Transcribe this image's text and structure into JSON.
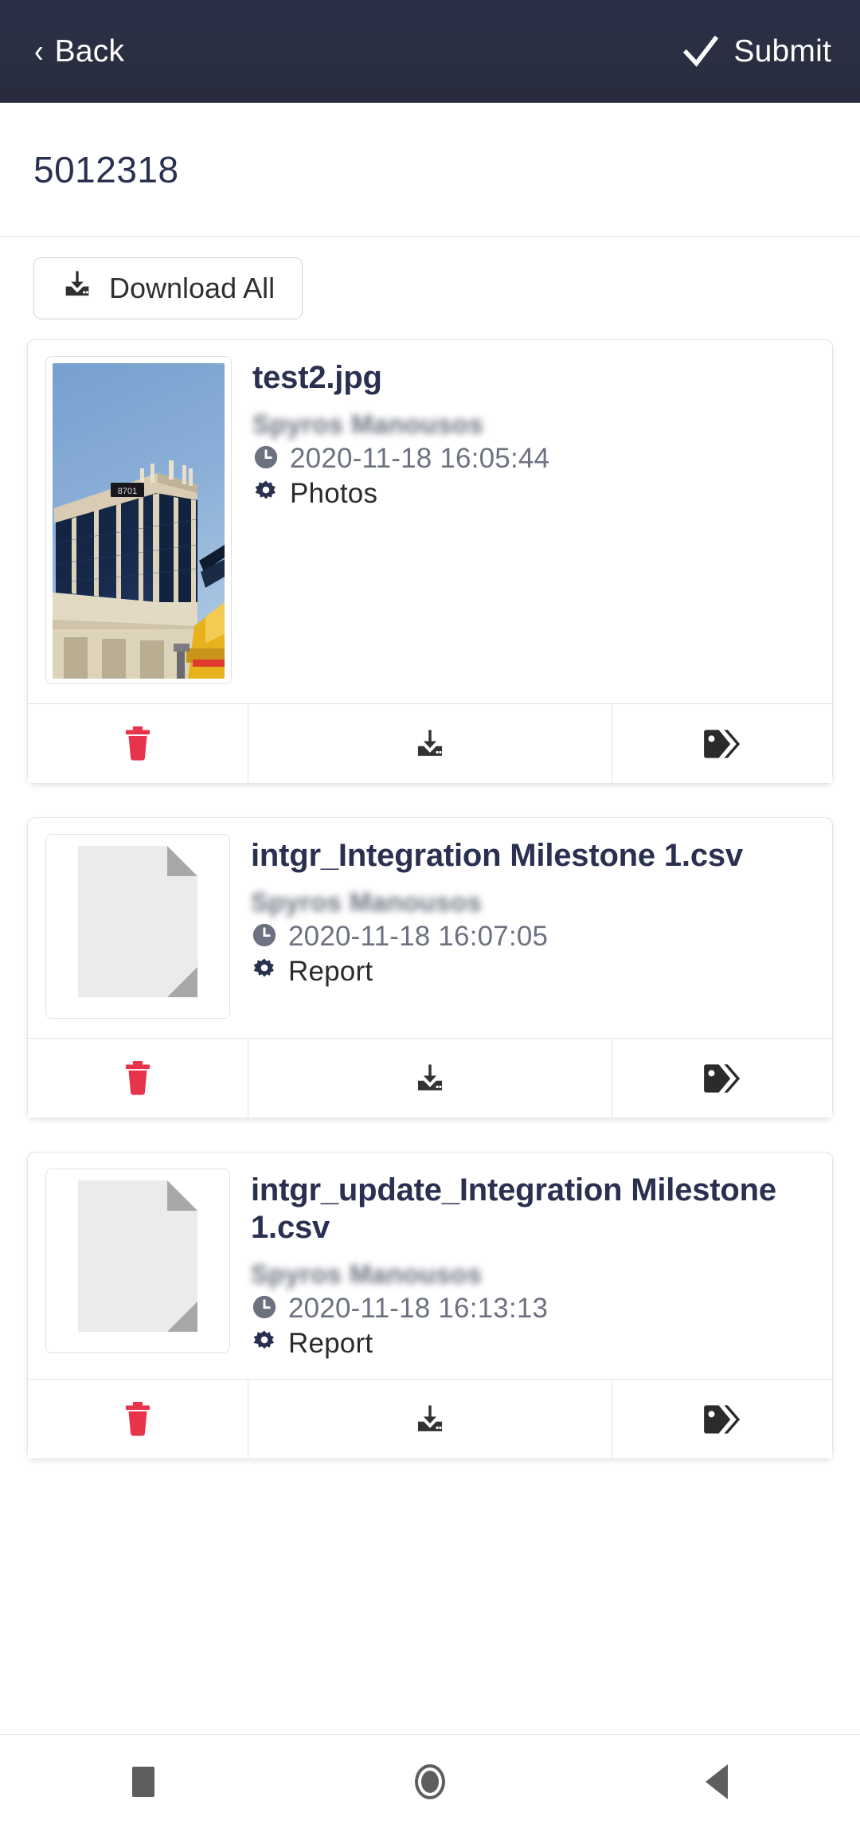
{
  "appbar": {
    "back_label": "Back",
    "back_icon": "chevron-left-icon",
    "submit_label": "Submit",
    "submit_icon": "check-icon",
    "background_color": "#2a2f42"
  },
  "header": {
    "title": "5012318"
  },
  "toolbar": {
    "download_all_label": "Download All",
    "download_all_icon": "download-icon"
  },
  "attachments": [
    {
      "file_name": "test2.jpg",
      "author": "Spyros Manousos",
      "timestamp": "2020-11-18 16:05:44",
      "category": "Photos",
      "thumb_type": "photo",
      "thumb_alt": "office building with dark glass facade, sign 8701, blue sky, yellow crane",
      "actions": [
        {
          "name": "delete",
          "icon": "trash-icon",
          "color": "#e8344b"
        },
        {
          "name": "download",
          "icon": "download-icon",
          "color": "#333333"
        },
        {
          "name": "tags",
          "icon": "tags-icon",
          "color": "#2b2b2b"
        }
      ]
    },
    {
      "file_name": "intgr_Integration Milestone 1.csv",
      "author": "Spyros Manousos",
      "timestamp": "2020-11-18 16:07:05",
      "category": "Report",
      "thumb_type": "document",
      "thumb_alt": "generic document placeholder with folded corner",
      "actions": [
        {
          "name": "delete",
          "icon": "trash-icon",
          "color": "#e8344b"
        },
        {
          "name": "download",
          "icon": "download-icon",
          "color": "#333333"
        },
        {
          "name": "tags",
          "icon": "tags-icon",
          "color": "#2b2b2b"
        }
      ]
    },
    {
      "file_name": "intgr_update_Integration Milestone 1.csv",
      "author": "Spyros Manousos",
      "timestamp": "2020-11-18 16:13:13",
      "category": "Report",
      "thumb_type": "document",
      "thumb_alt": "generic document placeholder with folded corner",
      "actions": [
        {
          "name": "delete",
          "icon": "trash-icon",
          "color": "#e8344b"
        },
        {
          "name": "download",
          "icon": "download-icon",
          "color": "#333333"
        },
        {
          "name": "tags",
          "icon": "tags-icon",
          "color": "#2b2b2b"
        }
      ]
    }
  ],
  "navbar": {
    "recents_icon": "square-icon",
    "home_icon": "circle-icon",
    "back_icon": "triangle-left-icon"
  }
}
